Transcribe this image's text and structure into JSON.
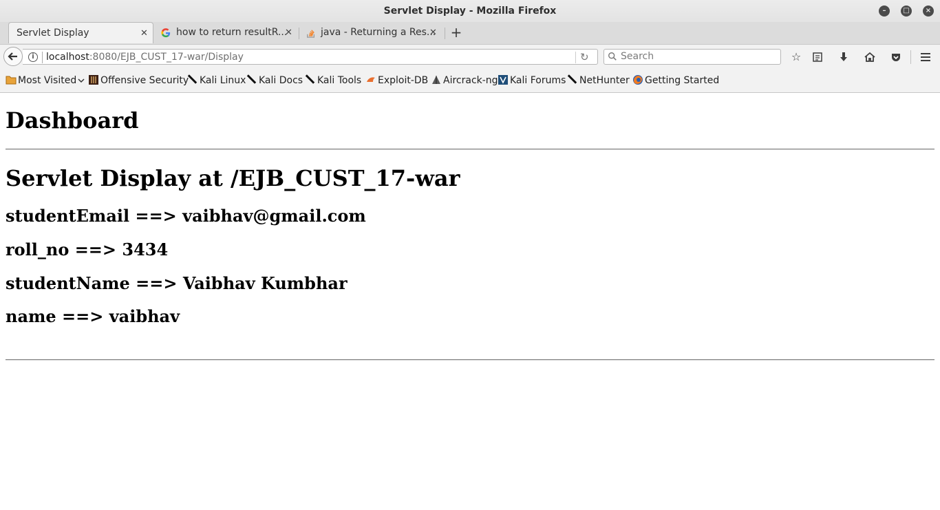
{
  "window": {
    "title": "Servlet Display - Mozilla Firefox"
  },
  "tabs": [
    {
      "label": "Servlet Display",
      "active": true,
      "favicon": "none"
    },
    {
      "label": "how to return resultR...",
      "active": false,
      "favicon": "google-icon"
    },
    {
      "label": "java - Returning a Res...",
      "active": false,
      "favicon": "stackoverflow-icon"
    }
  ],
  "navbar": {
    "url_host": "localhost",
    "url_path": ":8080/EJB_CUST_17-war/Display",
    "search_placeholder": "Search"
  },
  "bookmarks": [
    {
      "label": "Most Visited",
      "icon": "folder-icon",
      "dropdown": true
    },
    {
      "label": "Offensive Security",
      "icon": "offsec-icon"
    },
    {
      "label": "Kali Linux",
      "icon": "kali-dagger-icon"
    },
    {
      "label": "Kali Docs",
      "icon": "kali-dagger-icon"
    },
    {
      "label": "Kali Tools",
      "icon": "kali-dagger-icon"
    },
    {
      "label": "Exploit-DB",
      "icon": "exploitdb-icon"
    },
    {
      "label": "Aircrack-ng",
      "icon": "aircrack-icon"
    },
    {
      "label": "Kali Forums",
      "icon": "kali-forums-icon"
    },
    {
      "label": "NetHunter",
      "icon": "kali-dagger-icon"
    },
    {
      "label": "Getting Started",
      "icon": "firefox-icon"
    }
  ],
  "page": {
    "heading": "Dashboard",
    "subheading": "Servlet Display at /EJB_CUST_17-war",
    "fields": [
      "studentEmail ==> vaibhav@gmail.com",
      "roll_no ==> 3434",
      "studentName ==> Vaibhav Kumbhar",
      "name ==> vaibhav"
    ]
  },
  "colors": {
    "chrome": "#f2f2f2",
    "tabstrip": "#dcdcdc",
    "titlebar": "#e6e6e6",
    "page_background": "#ffffff",
    "text": "#000000"
  }
}
